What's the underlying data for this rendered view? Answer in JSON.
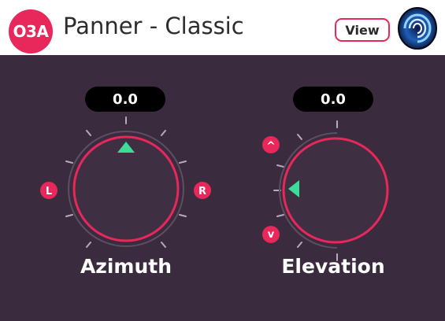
{
  "header": {
    "badge": "O3A",
    "title": "Panner - Classic",
    "view_label": "View",
    "logo_icon": "spiral-logo-icon"
  },
  "colors": {
    "accent": "#e8275a",
    "panel": "#3a2b3e",
    "knob_face": "#3f2f43",
    "indicator": "#3ddc97",
    "tick": "#b8aab9"
  },
  "knobs": {
    "azimuth": {
      "label": "Azimuth",
      "value": "0.0",
      "left_marker": "L",
      "right_marker": "R"
    },
    "elevation": {
      "label": "Elevation",
      "value": "0.0",
      "top_marker": "^",
      "bottom_marker": "v"
    }
  }
}
